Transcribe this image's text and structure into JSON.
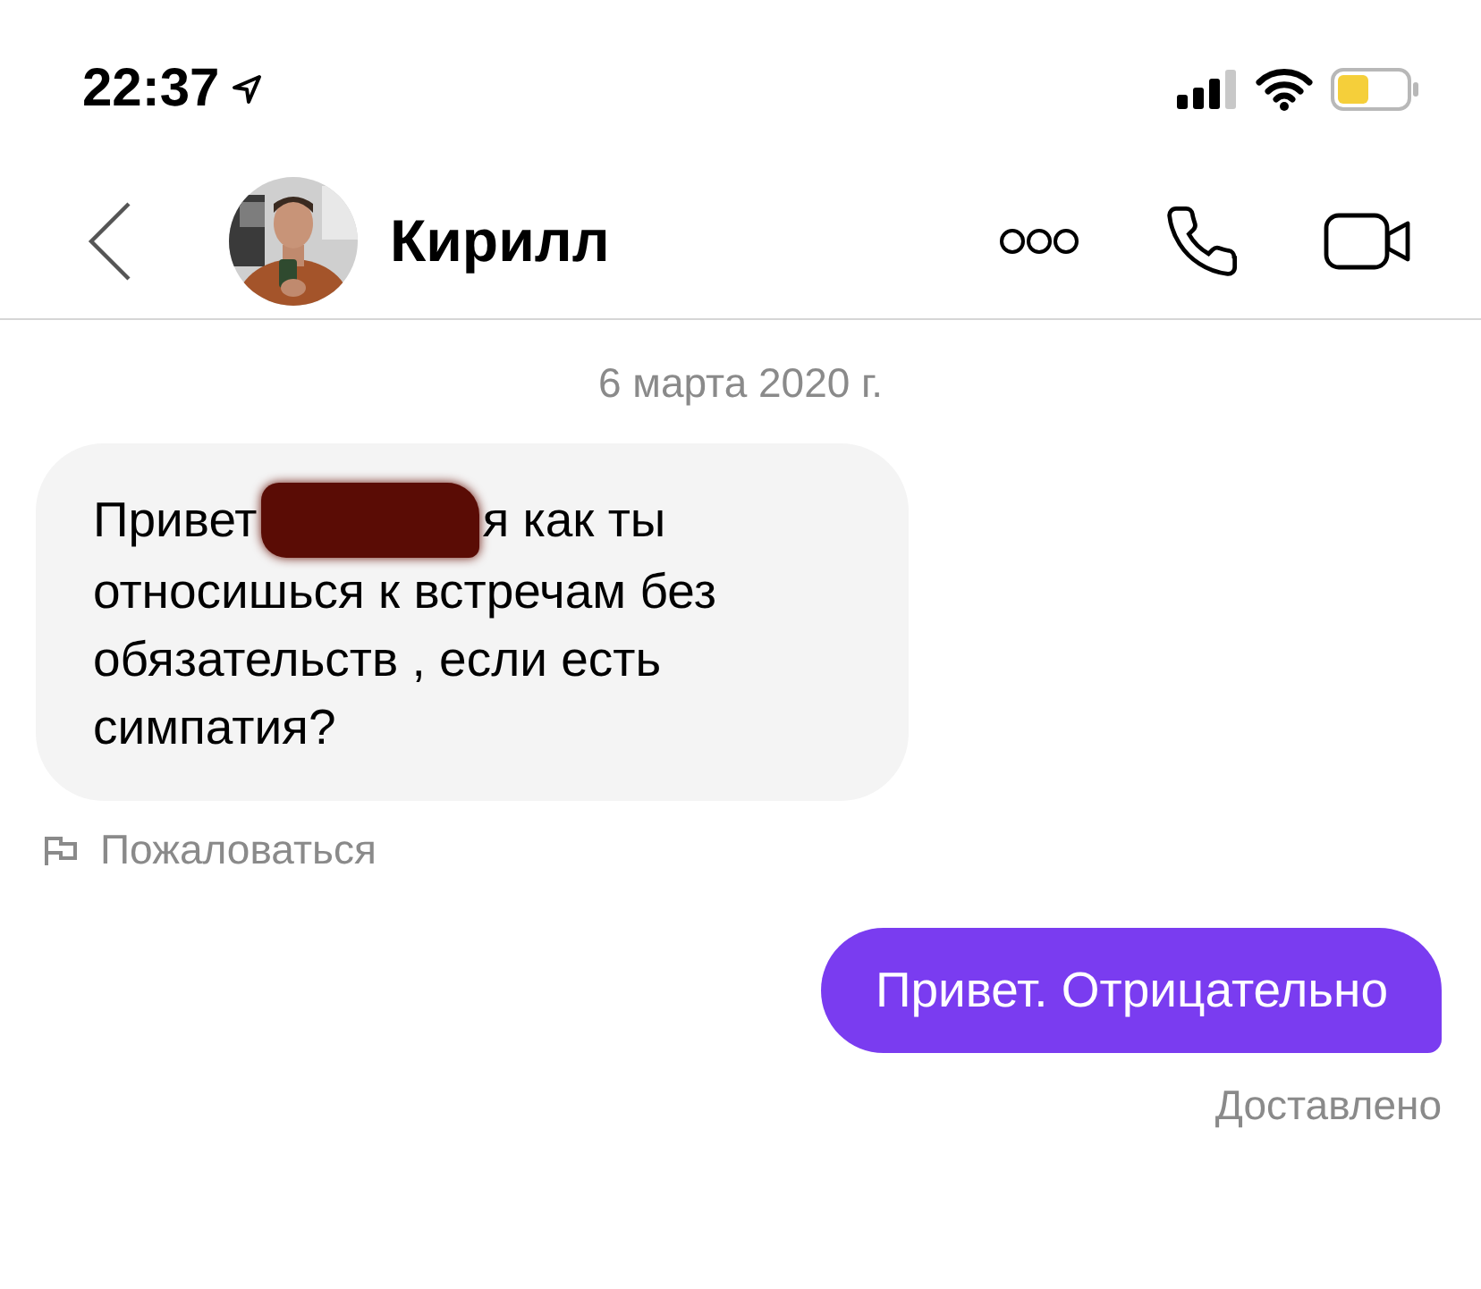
{
  "status_bar": {
    "time": "22:37"
  },
  "header": {
    "contact_name": "Кирилл"
  },
  "date_separator": "6 марта 2020 г.",
  "messages": [
    {
      "kind": "incoming",
      "parts": [
        "Привет",
        "я как ты",
        "относишься к встречам без обязательств , если есть симпатия?"
      ],
      "redacted": true,
      "action": "Пожаловаться"
    },
    {
      "kind": "outgoing",
      "text": "Привет. Отрицательно",
      "status": "Доставлено"
    }
  ]
}
